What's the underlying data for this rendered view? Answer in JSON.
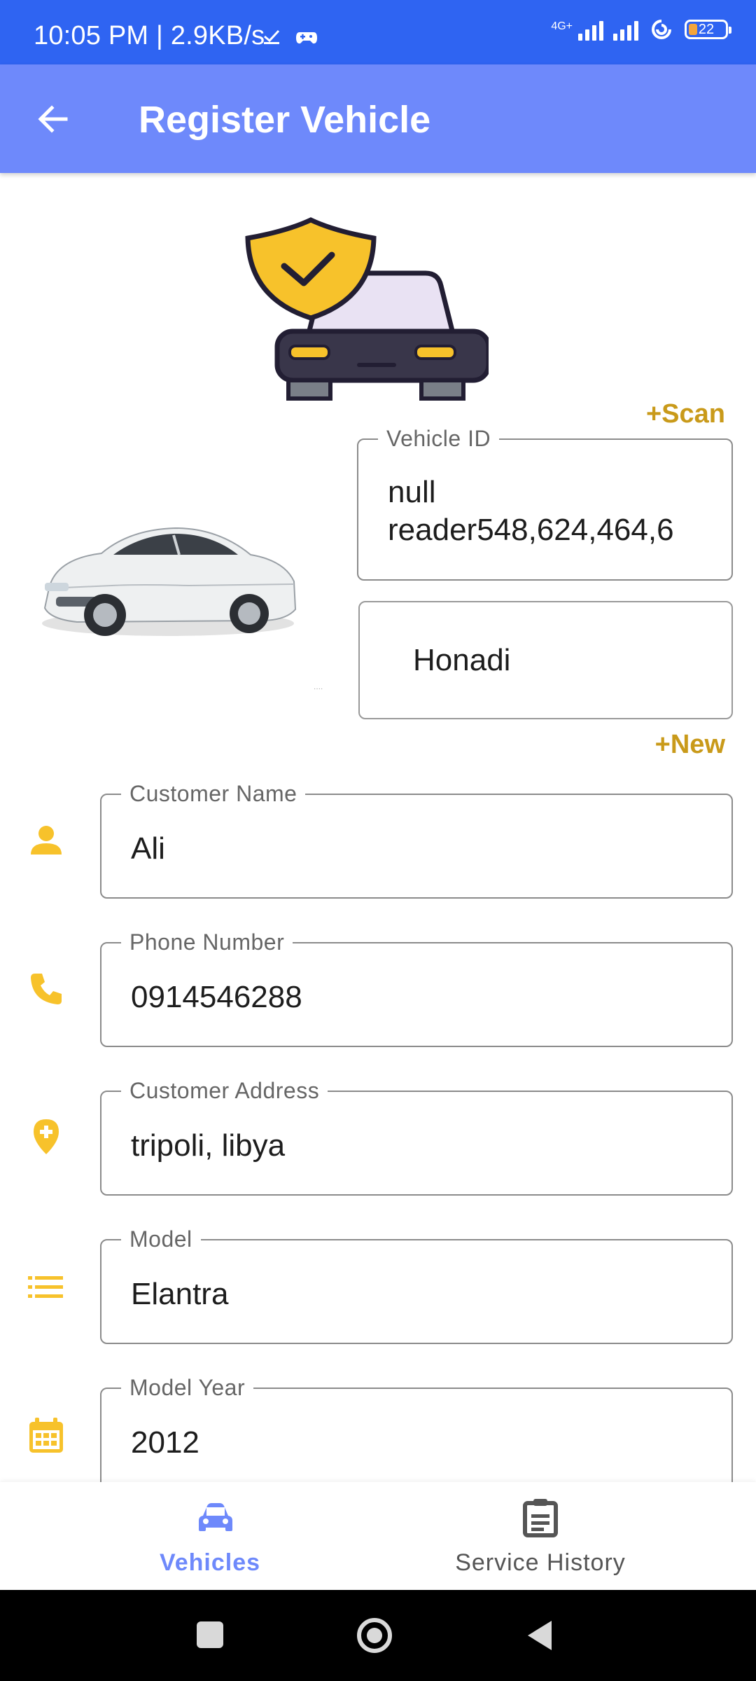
{
  "status_bar": {
    "time": "10:05 PM | 2.9KB/s",
    "network": "4G+",
    "battery": "22"
  },
  "app_bar": {
    "title": "Register Vehicle"
  },
  "actions": {
    "scan_label": "+Scan",
    "new_label": "+New"
  },
  "vehicle_id": {
    "label": "Vehicle ID",
    "value_line1": "null",
    "value_line2": "reader548,624,464,6"
  },
  "make": {
    "value": "Honadi"
  },
  "form": {
    "customer_name": {
      "label": "Customer Name",
      "value": "Ali"
    },
    "phone_number": {
      "label": "Phone Number",
      "value": "0914546288"
    },
    "customer_address": {
      "label": "Customer Address",
      "value": "tripoli, libya"
    },
    "model": {
      "label": "Model",
      "value": "Elantra"
    },
    "model_year": {
      "label": "Model Year",
      "value": "2012"
    }
  },
  "bottom_nav": {
    "vehicles_label": "Vehicles",
    "service_history_label": "Service History"
  },
  "colors": {
    "status_bar": "#2f64f2",
    "app_bar": "#6e89fb",
    "accent_gold": "#c99a1a",
    "icon_yellow": "#f7c22b",
    "nav_active": "#6e89fb"
  },
  "icons": {
    "back": "arrow-back-icon",
    "customer_name": "person-icon",
    "phone": "phone-icon",
    "address": "location-icon",
    "model": "list-icon",
    "year": "calendar-icon",
    "vehicles": "car-icon",
    "service_history": "document-icon"
  }
}
